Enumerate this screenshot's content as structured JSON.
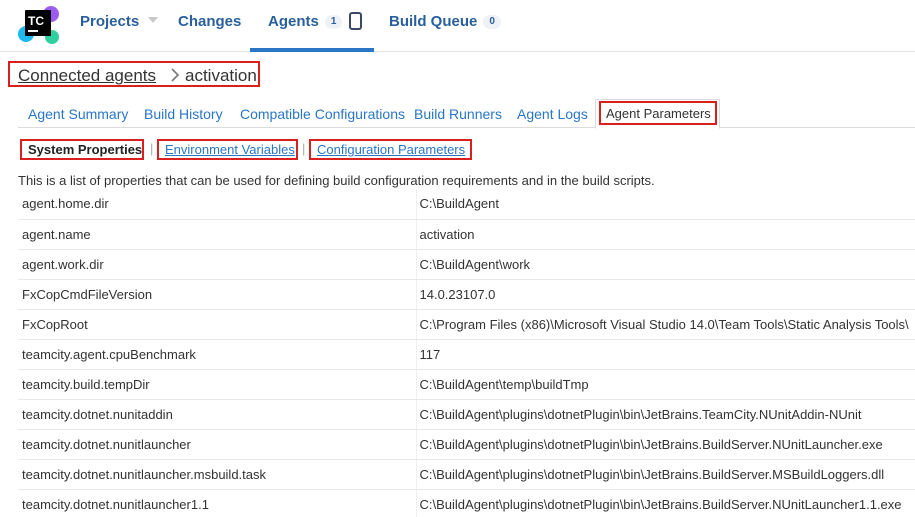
{
  "header": {
    "logo_text": "TC",
    "nav": {
      "projects": "Projects",
      "changes": "Changes",
      "agents": "Agents",
      "agents_count": "1",
      "build_queue": "Build Queue",
      "build_queue_count": "0"
    }
  },
  "breadcrumb": {
    "parent": "Connected agents",
    "current": "activation"
  },
  "tabs": [
    "Agent Summary",
    "Build History",
    "Compatible Configurations",
    "Build Runners",
    "Agent Logs",
    "Agent Parameters"
  ],
  "active_tab": "Agent Parameters",
  "subtabs": {
    "system": "System Properties",
    "environment": "Environment Variables",
    "configuration": "Configuration Parameters",
    "separator": "|"
  },
  "intro": "This is a list of properties that can be used for defining build configuration requirements and in the build scripts.",
  "properties": [
    {
      "name": "agent.home.dir",
      "value": "C:\\BuildAgent"
    },
    {
      "name": "agent.name",
      "value": "activation"
    },
    {
      "name": "agent.work.dir",
      "value": "C:\\BuildAgent\\work"
    },
    {
      "name": "FxCopCmdFileVersion",
      "value": "14.0.23107.0"
    },
    {
      "name": "FxCopRoot",
      "value": "C:\\Program Files (x86)\\Microsoft Visual Studio 14.0\\Team Tools\\Static Analysis Tools\\"
    },
    {
      "name": "teamcity.agent.cpuBenchmark",
      "value": "117"
    },
    {
      "name": "teamcity.build.tempDir",
      "value": "C:\\BuildAgent\\temp\\buildTmp"
    },
    {
      "name": "teamcity.dotnet.nunitaddin",
      "value": "C:\\BuildAgent\\plugins\\dotnetPlugin\\bin\\JetBrains.TeamCity.NUnitAddin-NUnit"
    },
    {
      "name": "teamcity.dotnet.nunitlauncher",
      "value": "C:\\BuildAgent\\plugins\\dotnetPlugin\\bin\\JetBrains.BuildServer.NUnitLauncher.exe"
    },
    {
      "name": "teamcity.dotnet.nunitlauncher.msbuild.task",
      "value": "C:\\BuildAgent\\plugins\\dotnetPlugin\\bin\\JetBrains.BuildServer.MSBuildLoggers.dll"
    },
    {
      "name": "teamcity.dotnet.nunitlauncher1.1",
      "value": "C:\\BuildAgent\\plugins\\dotnetPlugin\\bin\\JetBrains.BuildServer.NUnitLauncher1.1.exe"
    }
  ],
  "colors": {
    "link": "#2a76c6",
    "nav": "#2a5f9e",
    "highlight": "#d9201f"
  }
}
